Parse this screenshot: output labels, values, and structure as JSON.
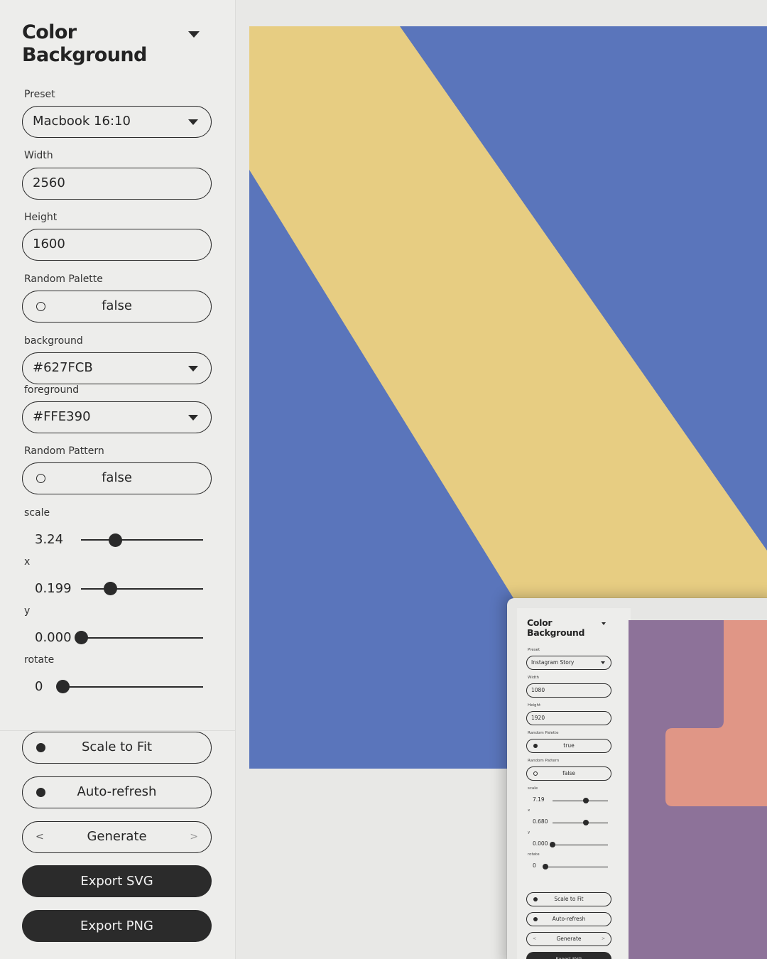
{
  "colors": {
    "accent_bg": "#5a75bb",
    "accent_fg": "#e7cd82",
    "preview_bg": "#8d7299",
    "preview_fg": "#e09686",
    "button_dark": "#2b2b2b"
  },
  "panel": {
    "title_line1": "Color",
    "title_line2": "Background",
    "preset": {
      "label": "Preset",
      "value": "Macbook 16:10"
    },
    "width": {
      "label": "Width",
      "value": "2560"
    },
    "height": {
      "label": "Height",
      "value": "1600"
    },
    "random_palette": {
      "label": "Random Palette",
      "value": "false"
    },
    "background": {
      "label": "background",
      "value": "#627FCB"
    },
    "foreground": {
      "label": "foreground",
      "value": "#FFE390"
    },
    "random_pattern": {
      "label": "Random Pattern",
      "value": "false"
    },
    "scale": {
      "label": "scale",
      "value": "3.24",
      "position": 0.28
    },
    "x": {
      "label": "x",
      "value": "0.199",
      "position": 0.24
    },
    "y": {
      "label": "y",
      "value": "0.000",
      "position": 0.0
    },
    "rotate": {
      "label": "rotate",
      "value": "0",
      "position": 0.0
    },
    "scale_to_fit": "Scale to Fit",
    "auto_refresh": "Auto-refresh",
    "generate": "Generate",
    "export_svg": "Export SVG",
    "export_png": "Export PNG",
    "chev_left": "<",
    "chev_right": ">"
  },
  "preview": {
    "title_line1": "Color",
    "title_line2": "Background",
    "preset": {
      "label": "Preset",
      "value": "Instagram Story"
    },
    "width": {
      "label": "Width",
      "value": "1080"
    },
    "height": {
      "label": "Height",
      "value": "1920"
    },
    "random_palette": {
      "label": "Random Palette",
      "value": "true"
    },
    "random_pattern": {
      "label": "Random Pattern",
      "value": "false"
    },
    "scale": {
      "label": "scale",
      "value": "7.19",
      "position": 0.6
    },
    "x": {
      "label": "x",
      "value": "0.680",
      "position": 0.6
    },
    "y": {
      "label": "y",
      "value": "0.000",
      "position": 0.0
    },
    "rotate": {
      "label": "rotate",
      "value": "0",
      "position": 0.0
    },
    "scale_to_fit": "Scale to Fit",
    "auto_refresh": "Auto-refresh",
    "generate": "Generate",
    "export_svg": "Export SVG",
    "chev_left": "<",
    "chev_right": ">"
  }
}
